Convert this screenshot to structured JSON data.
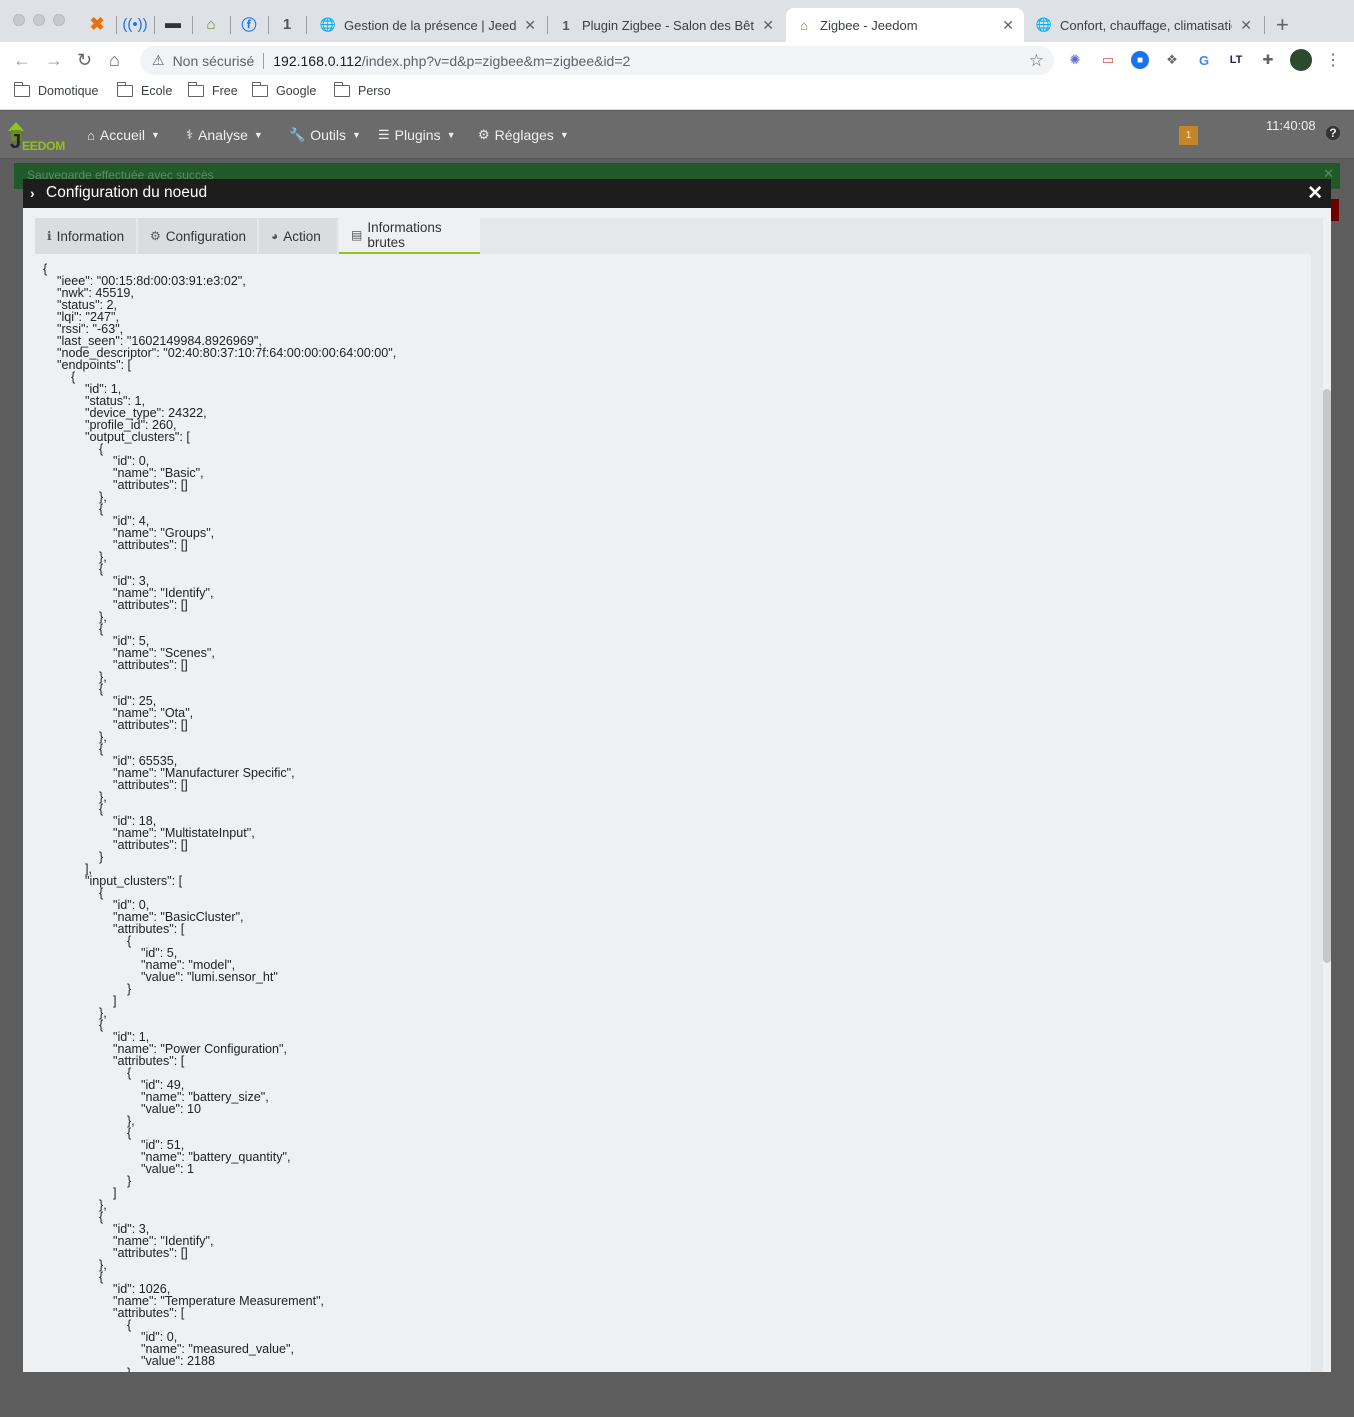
{
  "browser": {
    "tabs": [
      {
        "title": "Gestion de la présence | Jeedo",
        "favicon": "globe-icon"
      },
      {
        "title": "Plugin Zigbee - Salon des Bêta",
        "favicon": "one-icon"
      },
      {
        "title": "Zigbee - Jeedom",
        "favicon": "jeedom-icon",
        "active": true
      },
      {
        "title": "Confort, chauffage, climatisatio",
        "favicon": "globe-icon"
      }
    ],
    "address": {
      "security_label": "Non sécurisé",
      "host": "192.168.0.112",
      "path": "/index.php?v=d&p=zigbee&m=zigbee&id=2"
    },
    "bookmarks": [
      "Domotique",
      "Ecole",
      "Free",
      "Google",
      "Perso"
    ]
  },
  "jeedom": {
    "logo_text": "EEDOM",
    "menu": [
      {
        "label": "Accueil",
        "icon": "home-icon"
      },
      {
        "label": "Analyse",
        "icon": "stethoscope-icon"
      },
      {
        "label": "Outils",
        "icon": "wrench-icon"
      },
      {
        "label": "Plugins",
        "icon": "tasks-icon"
      },
      {
        "label": "Réglages",
        "icon": "gear-icon"
      }
    ],
    "notification_count": "1",
    "clock": "11:40:08",
    "success_message": "Sauvegarde effectuée avec succès",
    "accent_color": "#94c11f"
  },
  "modal": {
    "title": "Configuration du noeud",
    "tabs": [
      {
        "label": "Information",
        "icon": "info-icon"
      },
      {
        "label": "Configuration",
        "icon": "gear-icon"
      },
      {
        "label": "Action",
        "icon": "dashboard-icon"
      },
      {
        "label": "Informations brutes",
        "icon": "list-icon",
        "active": true
      }
    ],
    "raw_json": "{\n    \"ieee\": \"00:15:8d:00:03:91:e3:02\",\n    \"nwk\": 45519,\n    \"status\": 2,\n    \"lqi\": \"247\",\n    \"rssi\": \"-63\",\n    \"last_seen\": \"1602149984.8926969\",\n    \"node_descriptor\": \"02:40:80:37:10:7f:64:00:00:00:64:00:00\",\n    \"endpoints\": [\n        {\n            \"id\": 1,\n            \"status\": 1,\n            \"device_type\": 24322,\n            \"profile_id\": 260,\n            \"output_clusters\": [\n                {\n                    \"id\": 0,\n                    \"name\": \"Basic\",\n                    \"attributes\": []\n                },\n                {\n                    \"id\": 4,\n                    \"name\": \"Groups\",\n                    \"attributes\": []\n                },\n                {\n                    \"id\": 3,\n                    \"name\": \"Identify\",\n                    \"attributes\": []\n                },\n                {\n                    \"id\": 5,\n                    \"name\": \"Scenes\",\n                    \"attributes\": []\n                },\n                {\n                    \"id\": 25,\n                    \"name\": \"Ota\",\n                    \"attributes\": []\n                },\n                {\n                    \"id\": 65535,\n                    \"name\": \"Manufacturer Specific\",\n                    \"attributes\": []\n                },\n                {\n                    \"id\": 18,\n                    \"name\": \"MultistateInput\",\n                    \"attributes\": []\n                }\n            ],\n            \"input_clusters\": [\n                {\n                    \"id\": 0,\n                    \"name\": \"BasicCluster\",\n                    \"attributes\": [\n                        {\n                            \"id\": 5,\n                            \"name\": \"model\",\n                            \"value\": \"lumi.sensor_ht\"\n                        }\n                    ]\n                },\n                {\n                    \"id\": 1,\n                    \"name\": \"Power Configuration\",\n                    \"attributes\": [\n                        {\n                            \"id\": 49,\n                            \"name\": \"battery_size\",\n                            \"value\": 10\n                        },\n                        {\n                            \"id\": 51,\n                            \"name\": \"battery_quantity\",\n                            \"value\": 1\n                        }\n                    ]\n                },\n                {\n                    \"id\": 3,\n                    \"name\": \"Identify\",\n                    \"attributes\": []\n                },\n                {\n                    \"id\": 1026,\n                    \"name\": \"Temperature Measurement\",\n                    \"attributes\": [\n                        {\n                            \"id\": 0,\n                            \"name\": \"measured_value\",\n                            \"value\": 2188\n                        }"
  }
}
